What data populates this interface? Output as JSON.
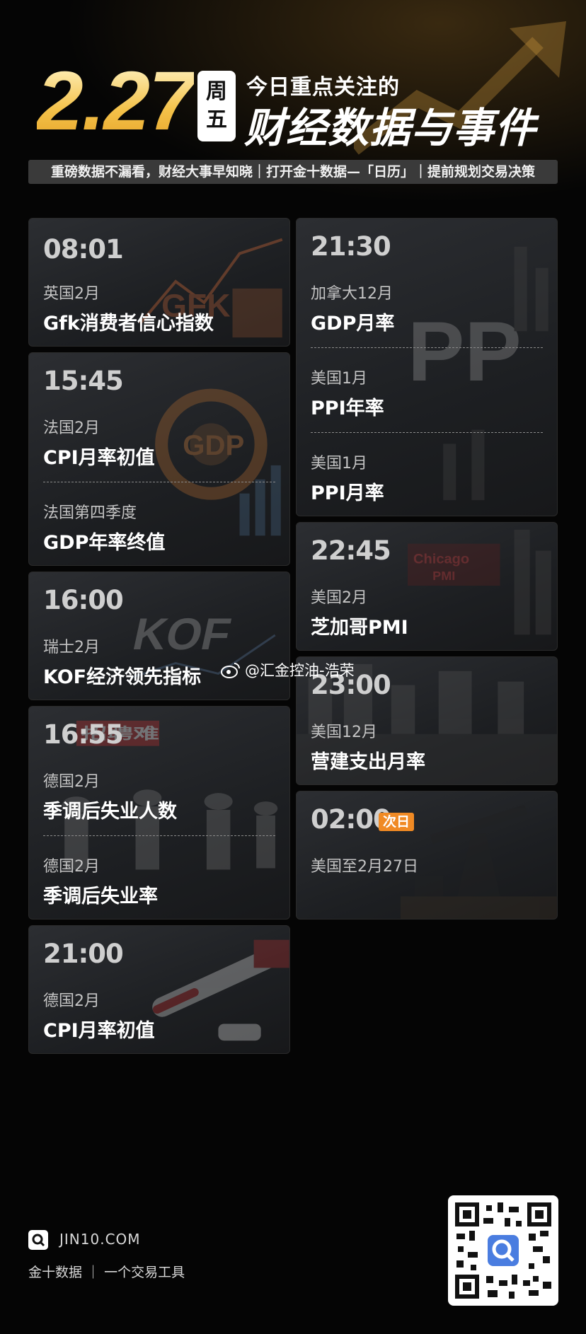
{
  "header": {
    "date": "2.27",
    "weekday_top": "周",
    "weekday_bottom": "五",
    "subtitle": "今日重点关注的",
    "title": "财经数据与事件",
    "tagline": "重磅数据不漏看，财经大事早知晓｜打开金十数据—「日历」｜提前规划交易决策"
  },
  "cards_left": [
    {
      "time": "08:01",
      "events": [
        {
          "country": "英国2月",
          "name": "Gfk消费者信心指数"
        }
      ]
    },
    {
      "time": "15:45",
      "events": [
        {
          "country": "法国2月",
          "name": "CPI月率初值"
        },
        {
          "country": "法国第四季度",
          "name": "GDP年率终值"
        }
      ]
    },
    {
      "time": "16:00",
      "events": [
        {
          "country": "瑞士2月",
          "name": "KOF经济领先指标"
        }
      ]
    },
    {
      "time": "16:55",
      "events": [
        {
          "country": "德国2月",
          "name": "季调后失业人数"
        },
        {
          "country": "德国2月",
          "name": "季调后失业率"
        }
      ]
    },
    {
      "time": "21:00",
      "events": [
        {
          "country": "德国2月",
          "name": "CPI月率初值"
        }
      ]
    }
  ],
  "cards_right": [
    {
      "time": "21:30",
      "events": [
        {
          "country": "加拿大12月",
          "name": "GDP月率"
        },
        {
          "country": "美国1月",
          "name": "PPI年率"
        },
        {
          "country": "美国1月",
          "name": "PPI月率"
        }
      ]
    },
    {
      "time": "22:45",
      "events": [
        {
          "country": "美国2月",
          "name": "芝加哥PMI"
        }
      ]
    },
    {
      "time": "23:00",
      "events": [
        {
          "country": "美国12月",
          "name": "营建支出月率"
        }
      ]
    },
    {
      "time": "02:00",
      "badge": "次日",
      "events": [
        {
          "country": "美国至2月27日",
          "name": ""
        }
      ]
    }
  ],
  "card_image_text": {
    "gfk": "GFK",
    "gdp": "GDP",
    "kof": "KOF",
    "ppi": "PP",
    "chicago": "Chicago",
    "pmi": "PMI",
    "hiring": "招聘难"
  },
  "weibo_watermark": "@汇金控油-浩荣",
  "footer": {
    "site": "JIN10.COM",
    "brand": "金十数据  ｜  一个交易工具"
  },
  "colors": {
    "date_gold": "#f4c24a",
    "badge_orange": "#f08a24",
    "tagline_bg": "#3a3a3a"
  }
}
